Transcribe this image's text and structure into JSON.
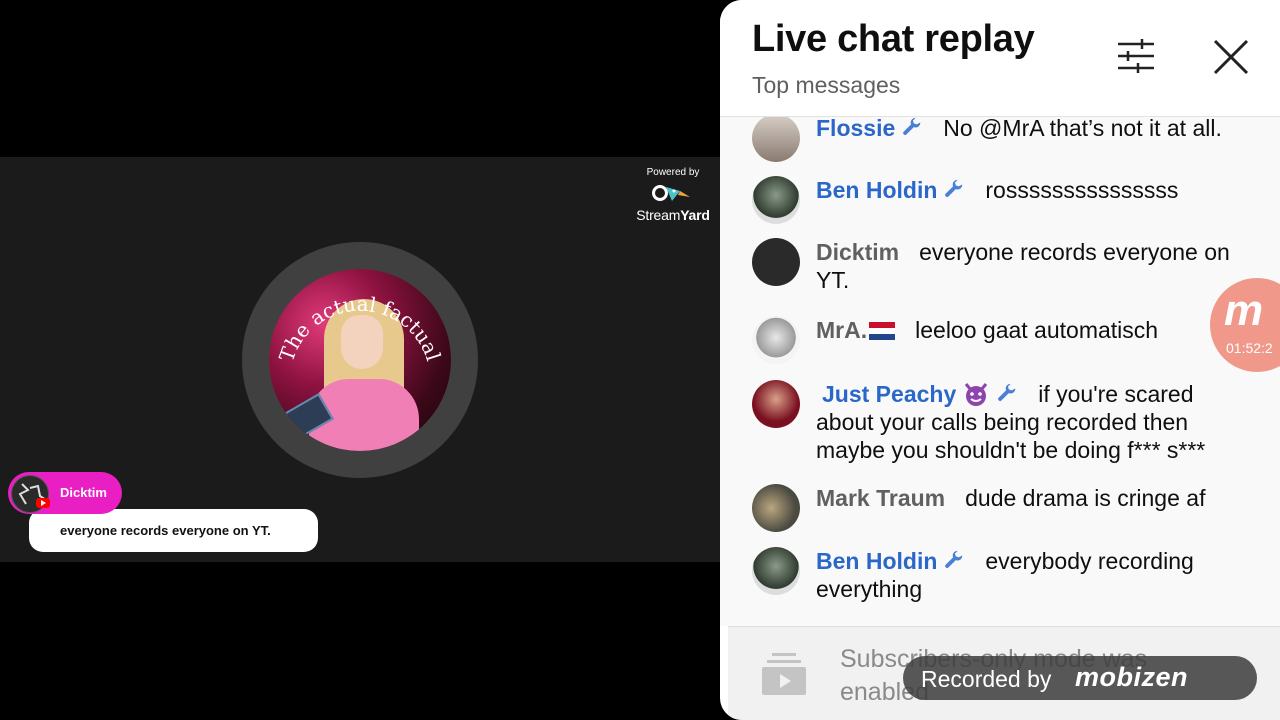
{
  "stream": {
    "powered_by": "Powered by",
    "brand_plain": "Stream",
    "brand_bold": "Yard",
    "avatar_text": "The actual factual",
    "lower_third": {
      "name": "Dicktim",
      "message": "everyone records everyone on YT."
    }
  },
  "chat": {
    "title": "Live chat replay",
    "subtitle": "Top messages",
    "messages": [
      {
        "author": "Flossie",
        "role": "moderator",
        "text": "No @MrA that’s not it at all."
      },
      {
        "author": "Ben Holdin",
        "role": "moderator",
        "text": "rosssssssssssssss"
      },
      {
        "author": "Dicktim",
        "role": "viewer",
        "text": "everyone records everyone on YT."
      },
      {
        "author": "MrA.",
        "role": "viewer",
        "text": "leeloo gaat automatisch"
      },
      {
        "author": "Just Peachy",
        "role": "moderator",
        "text": "if you're scared about your calls being recorded then maybe you shouldn't be doing f*** s***"
      },
      {
        "author": "Mark Traum",
        "role": "viewer",
        "text": "dude drama is cringe af"
      },
      {
        "author": "Ben Holdin",
        "role": "moderator",
        "text": "everybody recording everything"
      }
    ],
    "footer_notice": "Subscribers-only mode was enabled"
  },
  "recorder": {
    "timer": "01:52:2",
    "badge_letter": "m",
    "watermark_label": "Recorded by",
    "watermark_brand": "mobizen"
  },
  "icons": {
    "filter": "filter-sliders-icon",
    "close": "close-icon",
    "moderator": "wrench-icon",
    "flag": "netherlands-flag-icon",
    "emoji": "smiling-devil-emoji-icon",
    "footer": "subscriptions-icon"
  },
  "colors": {
    "moderator_name": "#2a67c9",
    "viewer_name": "#606060",
    "lower_third_accent": "#e91fc3",
    "recorder_badge": "#f08f80"
  }
}
